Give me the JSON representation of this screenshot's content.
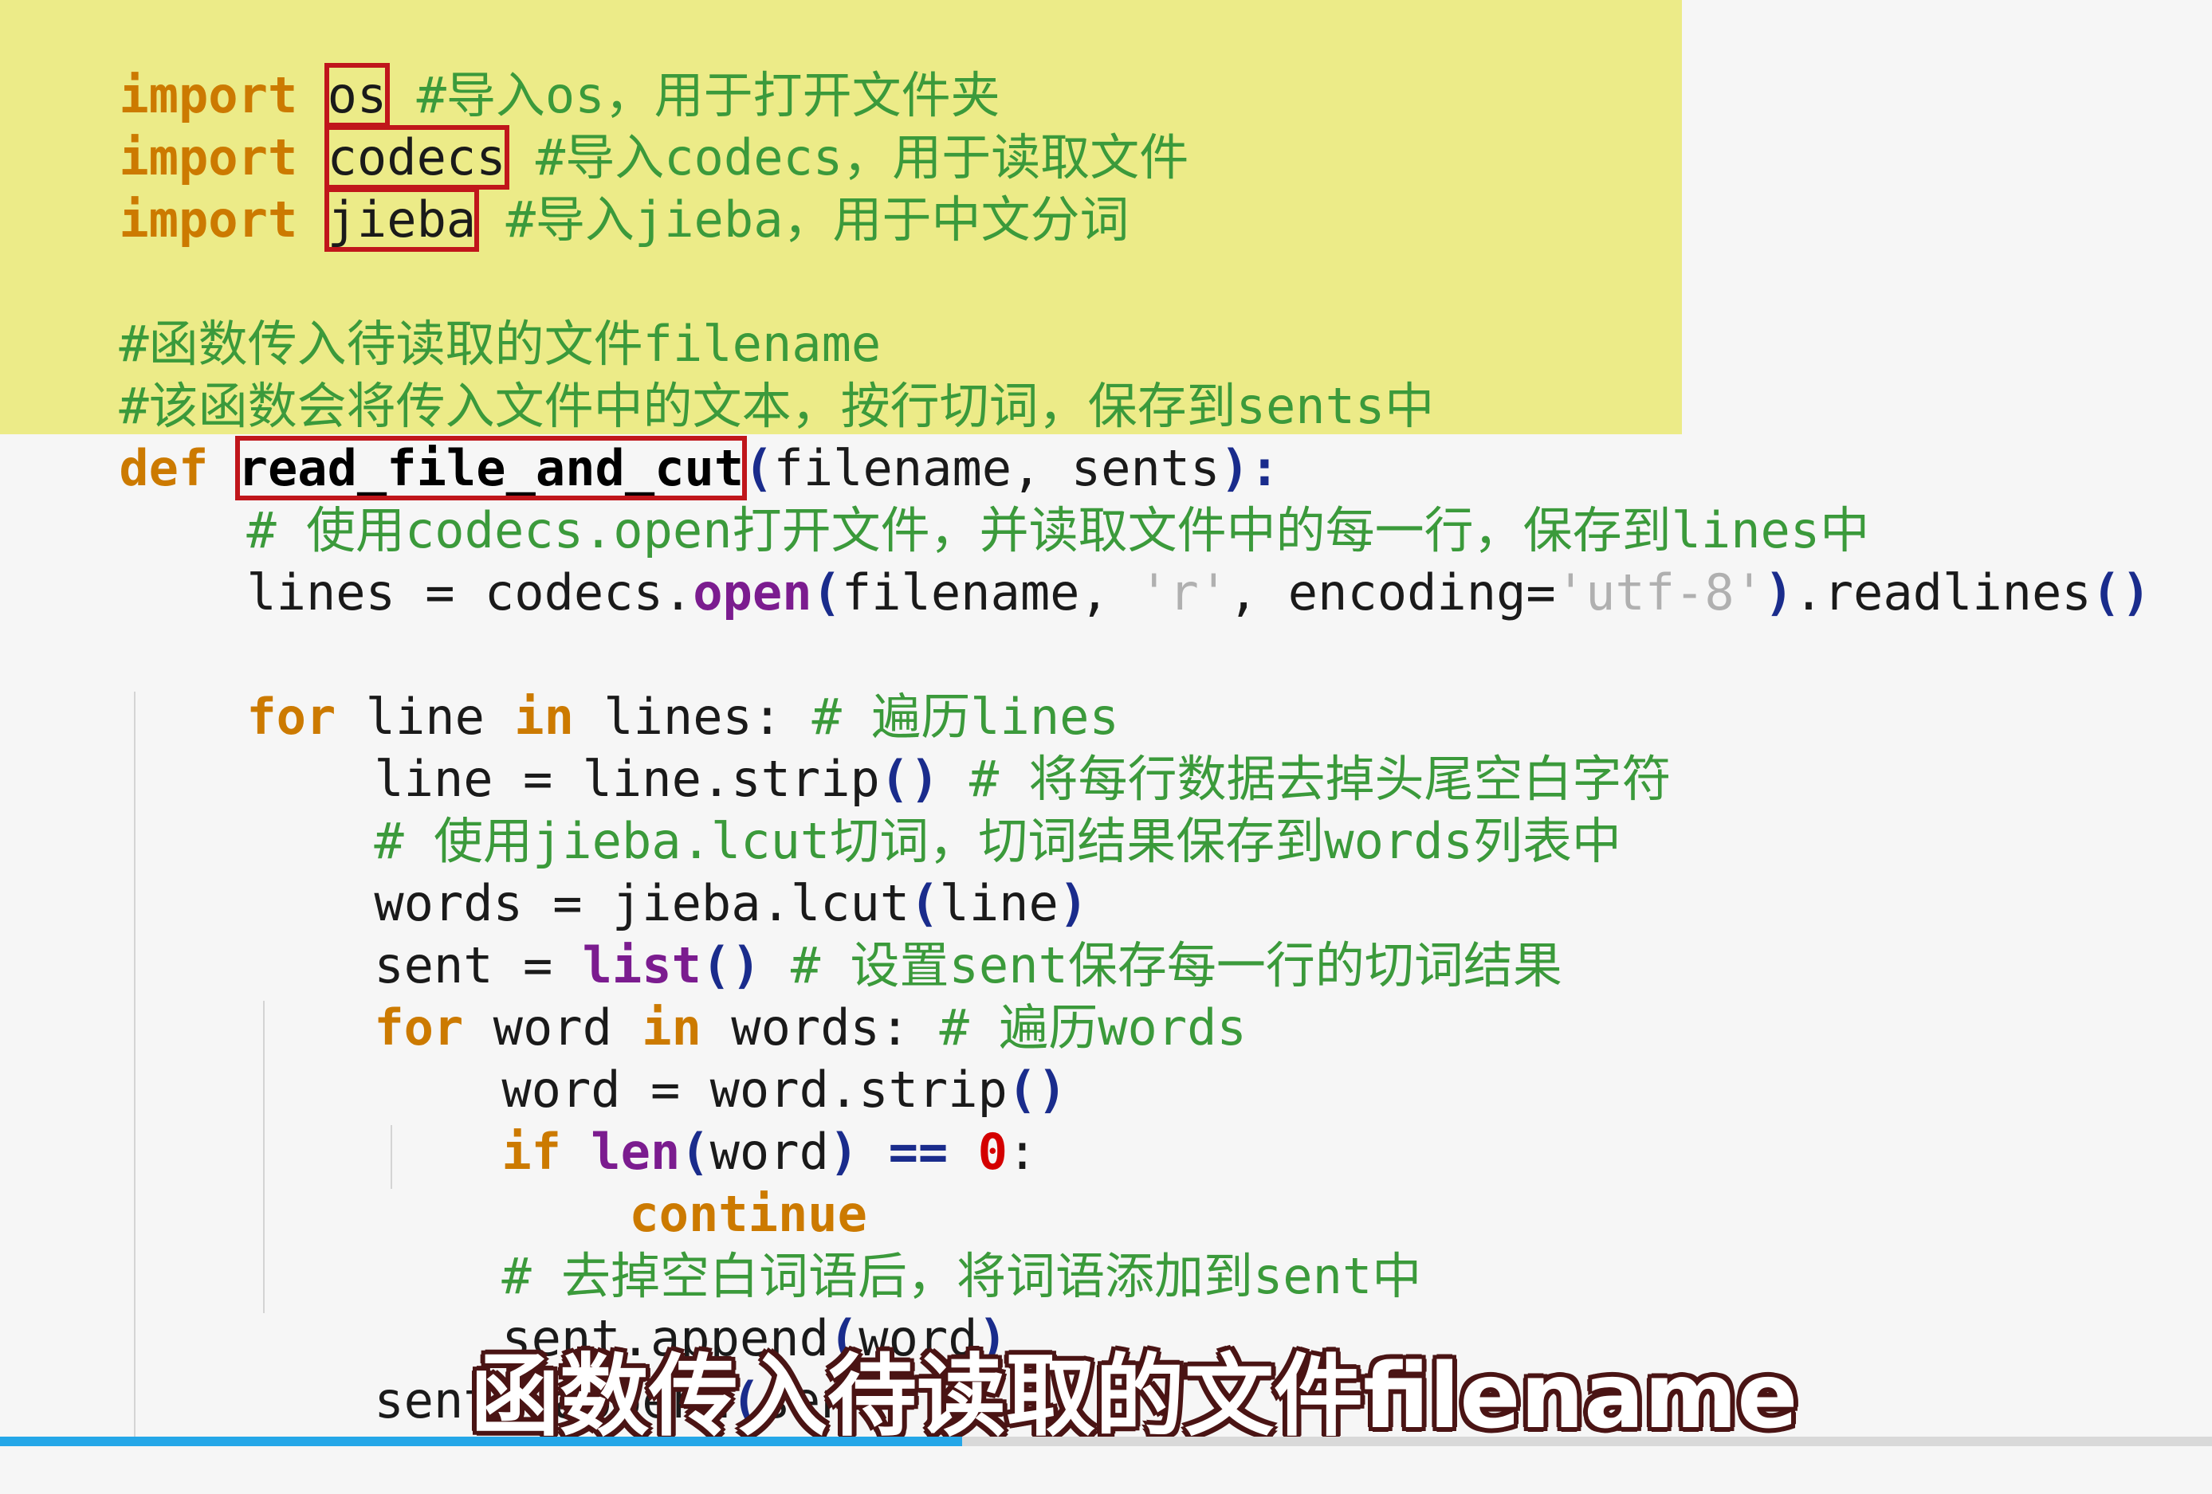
{
  "code": {
    "l1": {
      "kw": "import",
      "mod": "os",
      "cm": " #导入os，用于打开文件夹"
    },
    "l2": {
      "kw": "import",
      "mod": "codecs",
      "cm": " #导入codecs，用于读取文件"
    },
    "l3": {
      "kw": "import",
      "mod": "jieba",
      "cm": " #导入jieba，用于中文分词"
    },
    "l5": {
      "cm": "#函数传入待读取的文件filename"
    },
    "l6": {
      "cm": "#该函数会将传入文件中的文本，按行切词，保存到sents中"
    },
    "l7": {
      "kw": "def",
      "fn": "read_file_and_cut",
      "p1": "(",
      "args": "filename, sents",
      "p2": "):"
    },
    "l8": {
      "cm": "# 使用codecs.open打开文件，并读取文件中的每一行，保存到lines中"
    },
    "l9": {
      "a": "lines = codecs.",
      "b": "open",
      "c": "(",
      "d": "filename, ",
      "e": "'r'",
      "f": ", encoding=",
      "g": "'utf-8'",
      "h": ")",
      "i": ".readlines",
      "j": "()"
    },
    "l11": {
      "kw1": "for",
      "a": " line ",
      "kw2": "in",
      "b": " lines: ",
      "cm": "# 遍历lines"
    },
    "l12": {
      "a": "line = line.strip",
      "p": "()",
      "cm": " # 将每行数据去掉头尾空白字符"
    },
    "l13": {
      "cm": "# 使用jieba.lcut切词，切词结果保存到words列表中"
    },
    "l14": {
      "a": "words = jieba.lcut",
      "p1": "(",
      "b": "line",
      "p2": ")"
    },
    "l15": {
      "a": "sent = ",
      "bi": "list",
      "p": "()",
      "cm": " # 设置sent保存每一行的切词结果"
    },
    "l16": {
      "kw1": "for",
      "a": " word ",
      "kw2": "in",
      "b": " words: ",
      "cm": "# 遍历words"
    },
    "l17": {
      "a": "word = word.strip",
      "p": "()"
    },
    "l18": {
      "kw": "if",
      "sp": " ",
      "bi": "len",
      "p1": "(",
      "a": "word",
      "p2": ")",
      "op": " == ",
      "nu": "0",
      "c": ":"
    },
    "l19": {
      "kw": "continue"
    },
    "l20": {
      "cm": "# 去掉空白词语后，将词语添加到sent中"
    },
    "l21": {
      "a": "sent.append",
      "p1": "(",
      "b": "word",
      "p2": ")"
    },
    "l22": {
      "a": "sents.append",
      "p1": "(",
      "b": "sent",
      "p2": ")"
    }
  },
  "subtitle": "函数传入待读取的文件filename",
  "progress": {
    "fraction": 0.435
  },
  "colors": {
    "highlight": "#eceb88",
    "keyword": "#cc7a00",
    "comment": "#3b9a3b",
    "box": "#c0161b",
    "progress": "#25a7e8"
  }
}
